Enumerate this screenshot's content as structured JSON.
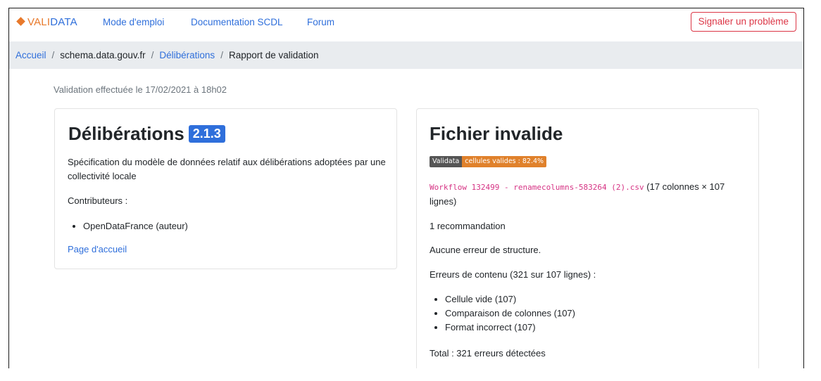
{
  "navbar": {
    "brand_prefix": "VALI",
    "brand_suffix": "DATA",
    "links": [
      "Mode d'emploi",
      "Documentation SCDL",
      "Forum"
    ],
    "report_button": "Signaler un problème"
  },
  "breadcrumb": {
    "home": "Accueil",
    "site": "schema.data.gouv.fr",
    "schema": "Délibérations",
    "current": "Rapport de validation",
    "separator": "/"
  },
  "validation_date": "Validation effectuée le 17/02/2021 à 18h02",
  "schema_card": {
    "title": "Délibérations",
    "version": "2.1.3",
    "description": "Spécification du modèle de données relatif aux délibérations adoptées par une collectivité locale",
    "contributors_label": "Contributeurs :",
    "contributors": [
      "OpenDataFrance (auteur)"
    ],
    "homepage_link": "Page d'accueil"
  },
  "report_card": {
    "title": "Fichier invalide",
    "badge_label": "Validata",
    "badge_value": "cellules valides : 82.4%",
    "filename": "Workflow 132499 - renamecolumns-583264 (2).csv",
    "file_dims": "(17 colonnes × 107 lignes)",
    "recommendations": "1 recommandation",
    "structure_errors": "Aucune erreur de structure.",
    "content_errors_label": "Erreurs de contenu (321 sur 107 lignes) :",
    "content_errors": [
      "Cellule vide (107)",
      "Comparaison de colonnes (107)",
      "Format incorrect (107)"
    ],
    "total": "Total : 321 erreurs détectées"
  },
  "colors": {
    "accent": "#2f6fdb",
    "brand_orange": "#e8792b",
    "danger": "#dc3545",
    "badge_orange": "#e0812b"
  }
}
